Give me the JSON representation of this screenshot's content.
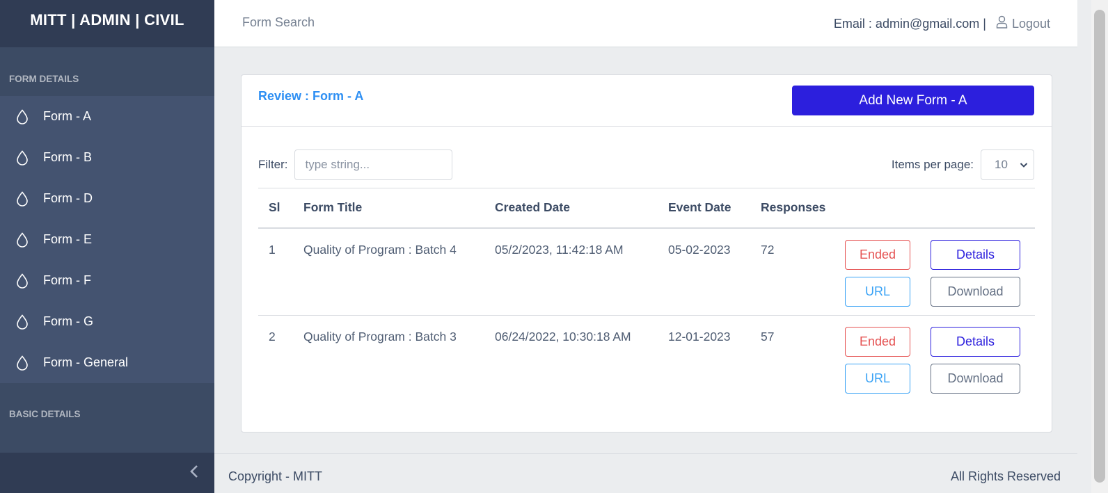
{
  "sidebar": {
    "brand": "MITT | ADMIN | CIVIL",
    "section1_title": "FORM DETAILS",
    "items": [
      {
        "label": "Form - A",
        "icon": "drop-icon"
      },
      {
        "label": "Form - B",
        "icon": "drop-icon"
      },
      {
        "label": "Form - D",
        "icon": "drop-icon"
      },
      {
        "label": "Form - E",
        "icon": "drop-icon"
      },
      {
        "label": "Form - F",
        "icon": "drop-icon"
      },
      {
        "label": "Form - G",
        "icon": "drop-icon"
      },
      {
        "label": "Form - General",
        "icon": "drop-icon"
      }
    ],
    "section2_title": "BASIC DETAILS",
    "toggler_icon": "chevron-left-icon"
  },
  "header": {
    "nav_link": "Form Search",
    "email": "Email : admin@gmail.com |",
    "logout_label": "Logout",
    "logout_icon": "user-icon"
  },
  "card": {
    "title": "Review : Form - A",
    "add_button_label": "Add New Form - A",
    "filter_label": "Filter:",
    "filter_placeholder": "type string...",
    "items_per_page_label": "Items per page:",
    "items_per_page_value": "10"
  },
  "table": {
    "columns": [
      "Sl",
      "Form Title",
      "Created Date",
      "Event Date",
      "Responses"
    ],
    "rows": [
      {
        "sl": "1",
        "title": "Quality of Program : Batch 4",
        "created": "05/2/2023, 11:42:18 AM",
        "event": "05-02-2023",
        "responses": "72"
      },
      {
        "sl": "2",
        "title": "Quality of Program : Batch 3",
        "created": "06/24/2022, 10:30:18 AM",
        "event": "12-01-2023",
        "responses": "57"
      }
    ],
    "actions": {
      "ended": "Ended",
      "details": "Details",
      "url": "URL",
      "download": "Download"
    }
  },
  "footer": {
    "left": "Copyright - MITT",
    "right": "All Rights Reserved"
  },
  "colors": {
    "sidebar": "#3c4b64",
    "brand_bg": "#303c54",
    "primary": "#2c1fdd",
    "title_blue": "#2e8ff3",
    "danger": "#e55353",
    "info": "#39a2f5"
  }
}
